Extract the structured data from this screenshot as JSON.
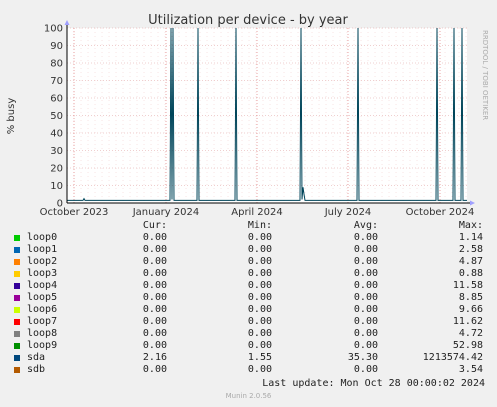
{
  "chart_data": {
    "type": "line",
    "title": "Utilization per device - by year",
    "ylabel": "% busy",
    "ylim": [
      0,
      100
    ],
    "yticks": [
      0,
      10,
      20,
      30,
      40,
      50,
      60,
      70,
      80,
      90,
      100
    ],
    "xticks": [
      "October 2023",
      "January 2024",
      "April 2024",
      "July 2024",
      "October 2024"
    ],
    "xrange": [
      "2023-09-24",
      "2024-10-28"
    ],
    "grid": true,
    "watermark": "RRDTOOL / TOBI OETIKER",
    "series": [
      {
        "name": "sda",
        "color": "#00455a",
        "points": [
          [
            "2023-09-24",
            1.5
          ],
          [
            "2023-10-10",
            1.5
          ],
          [
            "2023-10-11",
            2.5
          ],
          [
            "2023-10-12",
            1.5
          ],
          [
            "2024-01-05",
            1.5
          ],
          [
            "2024-01-06",
            100
          ],
          [
            "2024-01-07",
            2
          ],
          [
            "2024-01-08",
            100
          ],
          [
            "2024-01-09",
            1.5
          ],
          [
            "2024-02-01",
            1.5
          ],
          [
            "2024-02-02",
            100
          ],
          [
            "2024-02-03",
            1.5
          ],
          [
            "2024-03-10",
            1.5
          ],
          [
            "2024-03-11",
            100
          ],
          [
            "2024-03-12",
            1.5
          ],
          [
            "2024-05-14",
            1.5
          ],
          [
            "2024-05-15",
            100
          ],
          [
            "2024-05-16",
            2
          ],
          [
            "2024-05-17",
            9
          ],
          [
            "2024-05-18",
            5
          ],
          [
            "2024-05-19",
            1.5
          ],
          [
            "2024-07-10",
            1.5
          ],
          [
            "2024-07-11",
            100
          ],
          [
            "2024-07-12",
            1.5
          ],
          [
            "2024-09-27",
            1.5
          ],
          [
            "2024-09-28",
            100
          ],
          [
            "2024-09-29",
            1.5
          ],
          [
            "2024-10-14",
            1.5
          ],
          [
            "2024-10-15",
            100
          ],
          [
            "2024-10-16",
            1.5
          ],
          [
            "2024-10-22",
            1.5
          ],
          [
            "2024-10-23",
            100
          ],
          [
            "2024-10-24",
            1.5
          ],
          [
            "2024-10-28",
            1.5
          ]
        ]
      }
    ]
  },
  "legend": {
    "headers": {
      "cur": "Cur:",
      "min": "Min:",
      "avg": "Avg:",
      "max": "Max:"
    },
    "rows": [
      {
        "name": "loop0",
        "color": "#00cc00",
        "cur": "0.00",
        "min": "0.00",
        "avg": "0.00",
        "max": "1.14"
      },
      {
        "name": "loop1",
        "color": "#0066b3",
        "cur": "0.00",
        "min": "0.00",
        "avg": "0.00",
        "max": "2.58"
      },
      {
        "name": "loop2",
        "color": "#ff8000",
        "cur": "0.00",
        "min": "0.00",
        "avg": "0.00",
        "max": "4.87"
      },
      {
        "name": "loop3",
        "color": "#ffcc00",
        "cur": "0.00",
        "min": "0.00",
        "avg": "0.00",
        "max": "0.88"
      },
      {
        "name": "loop4",
        "color": "#330099",
        "cur": "0.00",
        "min": "0.00",
        "avg": "0.00",
        "max": "11.58"
      },
      {
        "name": "loop5",
        "color": "#990099",
        "cur": "0.00",
        "min": "0.00",
        "avg": "0.00",
        "max": "8.85"
      },
      {
        "name": "loop6",
        "color": "#ccff00",
        "cur": "0.00",
        "min": "0.00",
        "avg": "0.00",
        "max": "9.66"
      },
      {
        "name": "loop7",
        "color": "#ff0000",
        "cur": "0.00",
        "min": "0.00",
        "avg": "0.00",
        "max": "11.62"
      },
      {
        "name": "loop8",
        "color": "#808080",
        "cur": "0.00",
        "min": "0.00",
        "avg": "0.00",
        "max": "4.72"
      },
      {
        "name": "loop9",
        "color": "#008f00",
        "cur": "0.00",
        "min": "0.00",
        "avg": "0.00",
        "max": "52.98"
      },
      {
        "name": "sda",
        "color": "#00487d",
        "cur": "2.16",
        "min": "1.55",
        "avg": "35.30",
        "max": "1213574.42"
      },
      {
        "name": "sdb",
        "color": "#b35a00",
        "cur": "0.00",
        "min": "0.00",
        "avg": "0.00",
        "max": "3.54"
      }
    ]
  },
  "footer": {
    "last_update": "Last update: Mon Oct 28 00:00:02 2024",
    "version": "Munin 2.0.56"
  }
}
